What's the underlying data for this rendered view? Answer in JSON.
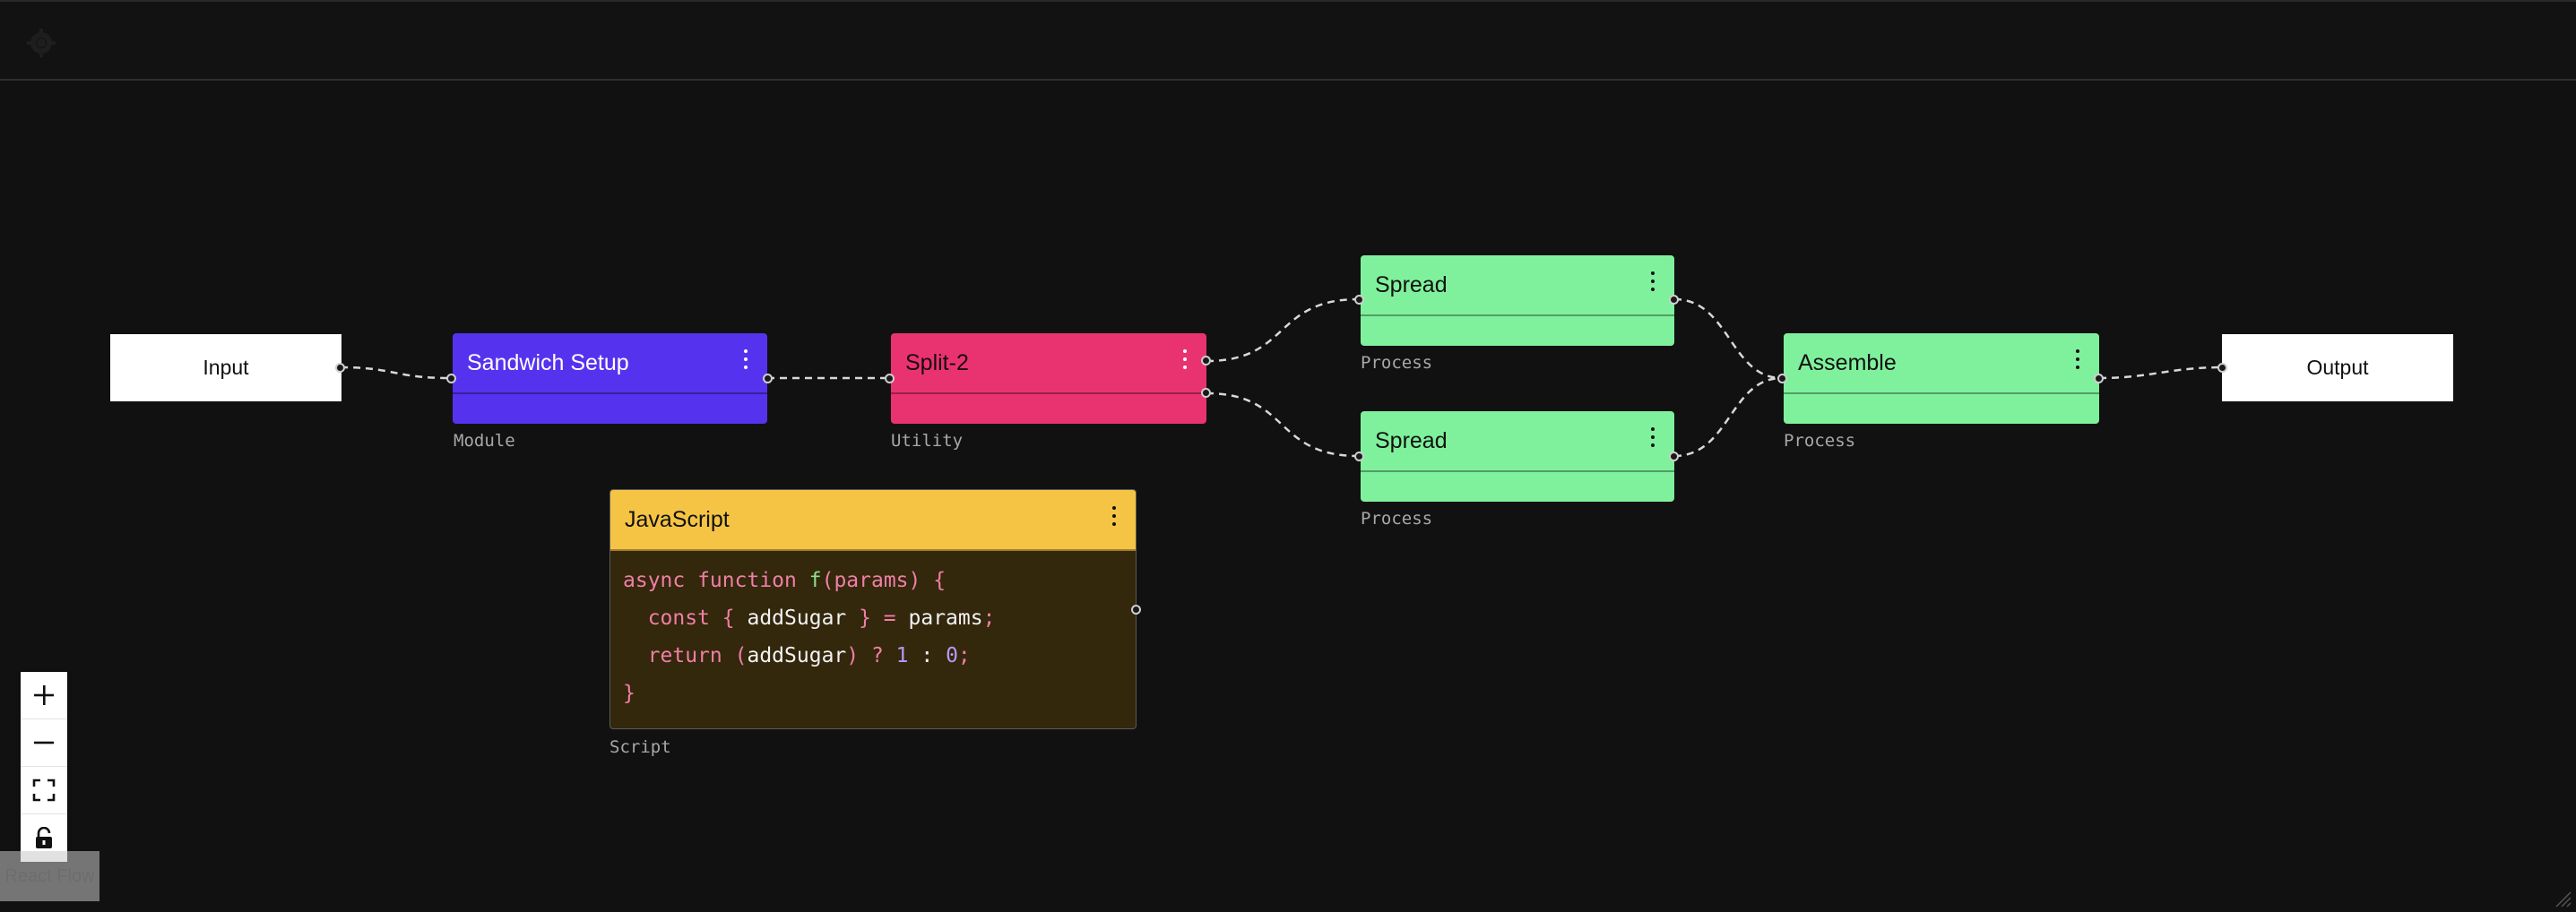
{
  "topbar": {
    "menu_icon": "crosshair-menu-icon"
  },
  "nodes": {
    "input": {
      "label": "Input"
    },
    "output": {
      "label": "Output"
    },
    "sandwich_setup": {
      "title": "Sandwich Setup",
      "type_label": "Module",
      "color": "#5533ee"
    },
    "split": {
      "title": "Split-2",
      "type_label": "Utility",
      "color": "#e93370"
    },
    "spread_top": {
      "title": "Spread",
      "type_label": "Process",
      "color": "#7ff19c"
    },
    "spread_bottom": {
      "title": "Spread",
      "type_label": "Process",
      "color": "#7ff19c"
    },
    "assemble": {
      "title": "Assemble",
      "type_label": "Process",
      "color": "#7ff19c"
    },
    "javascript": {
      "title": "JavaScript",
      "type_label": "Script",
      "color": "#f5c444",
      "body_color": "#33270c",
      "code_lines": [
        "async function f(params) {",
        "  const { addSugar } = params;",
        "  return (addSugar) ? 1 : 0;",
        "}"
      ]
    }
  },
  "controls": {
    "zoom_in": "plus-icon",
    "zoom_out": "minus-icon",
    "fit_view": "fit-view-icon",
    "lock": "lock-icon"
  },
  "attribution": {
    "label": "React Flow"
  }
}
